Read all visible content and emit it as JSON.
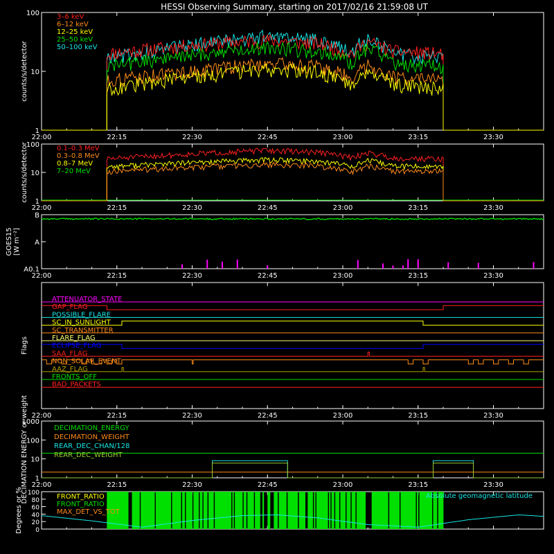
{
  "title": "HESSI Observing Summary, starting on 2017/02/16 21:59:08 UT",
  "colors": {
    "background": "#000000",
    "axis": "#ffffff",
    "red": "#ff2020",
    "orange": "#ff8c1a",
    "yellow": "#ffff00",
    "green": "#00e000",
    "cyan": "#19e6e6",
    "magenta": "#ff00ff",
    "blue": "#0000ff",
    "olive": "#b0a000",
    "pale_green": "#9acd32",
    "light_orange": "#ffa040",
    "pale_yellow": "#ffff70"
  },
  "time_axis": {
    "start": "22:00",
    "end": "23:40",
    "ticks": [
      "22:00",
      "22:15",
      "22:30",
      "22:45",
      "23:00",
      "23:15",
      "23:30"
    ]
  },
  "chart_data": [
    {
      "id": "low-energy",
      "type": "line",
      "ylabel": "counts/s/detector",
      "yscale": "log",
      "ylim": [
        1,
        100
      ],
      "yticks": [
        "1",
        "10",
        "100"
      ],
      "data_window": [
        "22:13",
        "23:20"
      ],
      "series": [
        {
          "name": "3–6 keV",
          "color": "#ff2020",
          "x": [
            "22:13",
            "22:30",
            "22:45",
            "22:55",
            "23:02",
            "23:05",
            "23:10",
            "23:20"
          ],
          "y": [
            20,
            28,
            34,
            30,
            20,
            32,
            22,
            20
          ]
        },
        {
          "name": "6–12 keV",
          "color": "#ff8c1a",
          "x": [
            "22:13",
            "22:30",
            "22:45",
            "22:55",
            "23:02",
            "23:05",
            "23:10",
            "23:20"
          ],
          "y": [
            7,
            10,
            14,
            12,
            8,
            13,
            8,
            7
          ]
        },
        {
          "name": "12–25 keV",
          "color": "#ffff00",
          "x": [
            "22:13",
            "22:30",
            "22:45",
            "22:55",
            "23:02",
            "23:05",
            "23:10",
            "23:20"
          ],
          "y": [
            5,
            8,
            11,
            10,
            6,
            11,
            6,
            5
          ]
        },
        {
          "name": "25–50 keV",
          "color": "#00e000",
          "x": [
            "22:13",
            "22:30",
            "22:45",
            "22:55",
            "23:02",
            "23:05",
            "23:10",
            "23:20"
          ],
          "y": [
            12,
            19,
            26,
            22,
            14,
            26,
            14,
            12
          ]
        },
        {
          "name": "50–100 keV",
          "color": "#19e6e6",
          "x": [
            "22:13",
            "22:30",
            "22:45",
            "22:55",
            "23:02",
            "23:05",
            "23:10",
            "23:20"
          ],
          "y": [
            17,
            28,
            40,
            34,
            21,
            40,
            20,
            17
          ]
        }
      ]
    },
    {
      "id": "high-energy",
      "type": "line",
      "ylabel": "counts/s/detector",
      "yscale": "log",
      "ylim": [
        1,
        100
      ],
      "yticks": [
        "1",
        "10",
        "100"
      ],
      "data_window": [
        "22:13",
        "23:20"
      ],
      "series": [
        {
          "name": "0.1–0.3 MeV",
          "color": "#ff2020",
          "x": [
            "22:13",
            "22:30",
            "22:45",
            "22:55",
            "23:02",
            "23:05",
            "23:10",
            "23:20"
          ],
          "y": [
            30,
            45,
            60,
            52,
            33,
            50,
            32,
            30
          ]
        },
        {
          "name": "0.3–0.8 MeV",
          "color": "#ff8c1a",
          "x": [
            "22:13",
            "22:30",
            "22:45",
            "22:55",
            "23:02",
            "23:05",
            "23:10",
            "23:20"
          ],
          "y": [
            11,
            15,
            19,
            17,
            11,
            17,
            11,
            11
          ]
        },
        {
          "name": "0.8–7 MeV",
          "color": "#ffff00",
          "x": [
            "22:13",
            "22:30",
            "22:45",
            "22:55",
            "23:02",
            "23:05",
            "23:10",
            "23:20"
          ],
          "y": [
            16,
            22,
            28,
            25,
            17,
            26,
            17,
            16
          ]
        },
        {
          "name": "7–20 MeV",
          "color": "#00e000",
          "x": [
            "22:00",
            "23:40"
          ],
          "y": [
            1,
            1
          ]
        }
      ]
    },
    {
      "id": "goes",
      "type": "line",
      "ylabel": "GOES15",
      "ylabel_unit": "[W m⁻²]",
      "yscale": "log",
      "ylim": [
        1e-09,
        1e-07
      ],
      "yticks": [
        "A0.1",
        "A",
        "B"
      ],
      "series": [
        {
          "name": "",
          "color": "#00e000",
          "x": [
            "22:00",
            "23:40"
          ],
          "y": [
            7e-08,
            7e-08
          ]
        }
      ],
      "spikes": {
        "color": "#ff00ff",
        "x": [
          "22:28",
          "22:33",
          "22:36",
          "22:39",
          "22:45",
          "23:03",
          "23:08",
          "23:10",
          "23:12",
          "23:13",
          "23:15",
          "23:21",
          "23:27",
          "23:38"
        ]
      }
    },
    {
      "id": "flags",
      "type": "line",
      "ylabel": "Flags",
      "series": [
        {
          "name": "ATTENUATOR_STATE",
          "color": "#ff00ff",
          "state": [
            [
              "22:00",
              0
            ]
          ]
        },
        {
          "name": "GAP_FLAG",
          "color": "#ff2020",
          "state": [
            [
              "22:00",
              1
            ],
            [
              "22:13",
              0
            ],
            [
              "23:20",
              1
            ]
          ]
        },
        {
          "name": "POSSIBLE_FLARE",
          "color": "#19e6e6",
          "state": [
            [
              "22:00",
              0
            ]
          ]
        },
        {
          "name": "SC_IN_SUNLIGHT",
          "color": "#ffff00",
          "state": [
            [
              "22:00",
              0
            ],
            [
              "22:16",
              1
            ],
            [
              "23:16",
              0
            ]
          ]
        },
        {
          "name": "SC_TRANSMITTER",
          "color": "#ff8c1a",
          "state": [
            [
              "22:00",
              0
            ]
          ]
        },
        {
          "name": "FLARE_FLAG",
          "color": "#ffff70",
          "state": [
            [
              "22:00",
              0
            ]
          ]
        },
        {
          "name": "ECLIPSE_FLAG",
          "color": "#0000ff",
          "state": [
            [
              "22:00",
              1
            ],
            [
              "22:16",
              0
            ],
            [
              "23:16",
              1
            ]
          ]
        },
        {
          "name": "SAA_FLAG",
          "color": "#ff2020",
          "state": [
            [
              "22:00",
              0
            ],
            [
              "23:05",
              1
            ],
            [
              "23:05.3",
              0
            ]
          ]
        },
        {
          "name": "NON_SOLAR_EVENT",
          "color": "#ff8c1a",
          "state": [
            [
              "22:00",
              1
            ],
            [
              "22:01",
              0
            ],
            [
              "22:02",
              1
            ],
            [
              "22:04",
              0
            ],
            [
              "22:05",
              1
            ],
            [
              "22:08",
              0
            ],
            [
              "22:09",
              1
            ],
            [
              "22:10",
              0
            ],
            [
              "22:12",
              1
            ],
            [
              "22:13",
              0
            ],
            [
              "22:14",
              1
            ],
            [
              "22:15",
              0
            ],
            [
              "22:16",
              1
            ],
            [
              "22:30",
              0
            ],
            [
              "22:30.2",
              1
            ],
            [
              "23:13",
              0
            ],
            [
              "23:14",
              1
            ],
            [
              "23:16",
              0
            ],
            [
              "23:17",
              1
            ],
            [
              "23:25",
              0
            ],
            [
              "23:26",
              1
            ],
            [
              "23:27",
              0
            ],
            [
              "23:28",
              1
            ],
            [
              "23:30",
              0
            ],
            [
              "23:31",
              1
            ],
            [
              "23:33",
              0
            ],
            [
              "23:34",
              1
            ],
            [
              "23:36",
              0
            ],
            [
              "23:37",
              1
            ]
          ]
        },
        {
          "name": "AAZ_FLAG",
          "color": "#b0a000",
          "state": [
            [
              "22:00",
              0
            ],
            [
              "22:16",
              1
            ],
            [
              "22:16.3",
              0
            ],
            [
              "23:16",
              1
            ],
            [
              "23:16.3",
              0
            ]
          ]
        },
        {
          "name": "FRONTS_OFF",
          "color": "#00e000",
          "state": [
            [
              "22:00",
              0
            ]
          ]
        },
        {
          "name": "BAD_PACKETS",
          "color": "#ff2020",
          "state": [
            [
              "22:00",
              0
            ]
          ]
        }
      ]
    },
    {
      "id": "decimation",
      "type": "line",
      "ylabel": "DECIMATION ENERGY or weight",
      "yscale": "log",
      "ylim": [
        1,
        1000
      ],
      "yticks": [
        "1",
        "10",
        "100",
        "1000"
      ],
      "series": [
        {
          "name": "DECIMATION_ENERGY",
          "color": "#00e000",
          "x": [
            "22:00",
            "23:40"
          ],
          "y": [
            20,
            20
          ]
        },
        {
          "name": "DECIMATION_WEIGHT",
          "color": "#ff8c1a",
          "x": [
            "22:00",
            "23:40"
          ],
          "y": [
            2,
            2
          ]
        },
        {
          "name": "REAR_DEC_CHAN/128",
          "color": "#19e6e6",
          "x": [
            "22:00",
            "22:34",
            "22:34",
            "22:49",
            "22:49",
            "23:18",
            "23:18",
            "23:26",
            "23:26",
            "23:40"
          ],
          "y": [
            1,
            1,
            8,
            8,
            1,
            1,
            8,
            8,
            1,
            1
          ]
        },
        {
          "name": "REAR_DEC_WEIGHT",
          "color": "#9acd32",
          "x": [
            "22:00",
            "22:34",
            "22:34",
            "22:49",
            "22:49",
            "23:18",
            "23:18",
            "23:26",
            "23:26",
            "23:40"
          ],
          "y": [
            1,
            1,
            6,
            6,
            1,
            1,
            6,
            6,
            1,
            1
          ]
        }
      ]
    },
    {
      "id": "ratios",
      "type": "line",
      "ylabel": "Degrees or %",
      "ylim": [
        0,
        100
      ],
      "yticks": [
        "0",
        "20",
        "40",
        "60",
        "80",
        "100"
      ],
      "series": [
        {
          "name": "FRONT_RATIO",
          "color": "#ffff00",
          "x": [],
          "y": []
        },
        {
          "name": "FRONT_RATIO",
          "color": "#00e000",
          "fill_window": [
            "22:13",
            "23:20"
          ]
        },
        {
          "name": "MAX_DET_VS_TOT",
          "color": "#ff8c1a",
          "x": [],
          "y": []
        },
        {
          "name": "Absolute geomagnetic latitude",
          "color": "#19e6e6",
          "x": [
            "22:00",
            "22:10",
            "22:20",
            "22:30",
            "22:40",
            "22:47",
            "22:55",
            "23:05",
            "23:15",
            "23:25",
            "23:35",
            "23:40"
          ],
          "y": [
            36,
            22,
            5,
            23,
            36,
            38,
            30,
            12,
            5,
            25,
            38,
            34
          ]
        }
      ]
    }
  ]
}
